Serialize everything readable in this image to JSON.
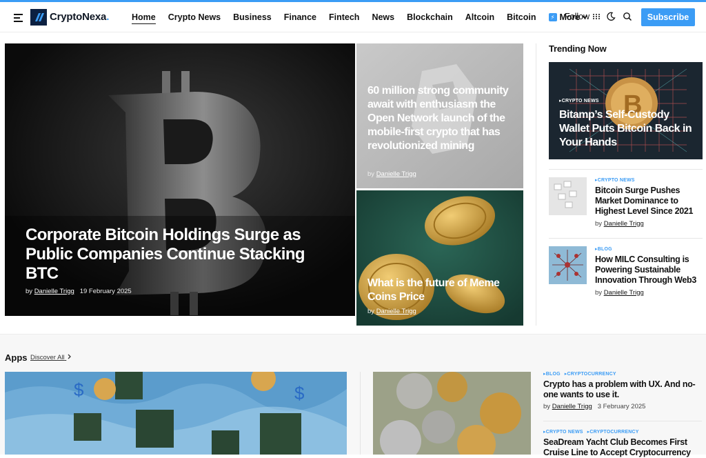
{
  "brand": {
    "name": "CryptoNexa",
    "dot": "."
  },
  "nav": {
    "items": [
      "Home",
      "Crypto News",
      "Business",
      "Finance",
      "Fintech",
      "News",
      "Blockchain",
      "Altcoin",
      "Bitcoin"
    ],
    "more_label": "More",
    "follow_label": "Follow",
    "subscribe_label": "Subscribe"
  },
  "hero": {
    "title": "Corporate Bitcoin Holdings Surge as Public Companies Continue Stacking BTC",
    "by": "by",
    "author": "Danielle Trigg",
    "date": "19 February 2025"
  },
  "card_top": {
    "title": "60 million strong community await with enthusiasm the Open Network launch of the mobile-first crypto that has revolutionized mining",
    "by": "by",
    "author": "Danielle Trigg"
  },
  "card_bottom": {
    "title": "What is the future of Meme Coins Price",
    "by": "by",
    "author": "Danielle Trigg"
  },
  "trending": {
    "heading": "Trending Now",
    "feature": {
      "tag": "Crypto News",
      "title": "Bitamp’s Self-Custody Wallet Puts Bitcoin Back in Your Hands"
    },
    "items": [
      {
        "tag": "Crypto News",
        "title": "Bitcoin Surge Pushes Market Dominance to Highest Level Since 2021",
        "by": "by",
        "author": "Danielle Trigg"
      },
      {
        "tag": "Blog",
        "title": "How MILC Consulting is Powering Sustainable Innovation Through Web3",
        "by": "by",
        "author": "Danielle Trigg"
      }
    ]
  },
  "apps": {
    "heading": "Apps",
    "discover_label": "Discover All",
    "items": [
      {
        "tags": [
          "Blog",
          "Cryptocurrency"
        ],
        "title": "Crypto has a problem with UX. And no-one wants to use it.",
        "by": "by",
        "author": "Danielle Trigg",
        "date": "3 February 2025"
      },
      {
        "tags": [
          "Crypto News",
          "Cryptocurrency"
        ],
        "title": "SeaDream Yacht Club Becomes First Cruise Line to Accept Cryptocurrency"
      }
    ]
  },
  "colors": {
    "accent": "#3b9cf5",
    "logo_bg": "#0c2041"
  },
  "icons": [
    "menu-icon",
    "follow-grid-icon",
    "moon-icon",
    "search-icon",
    "bolt-icon",
    "chevron-down-icon",
    "chevron-right-icon"
  ]
}
